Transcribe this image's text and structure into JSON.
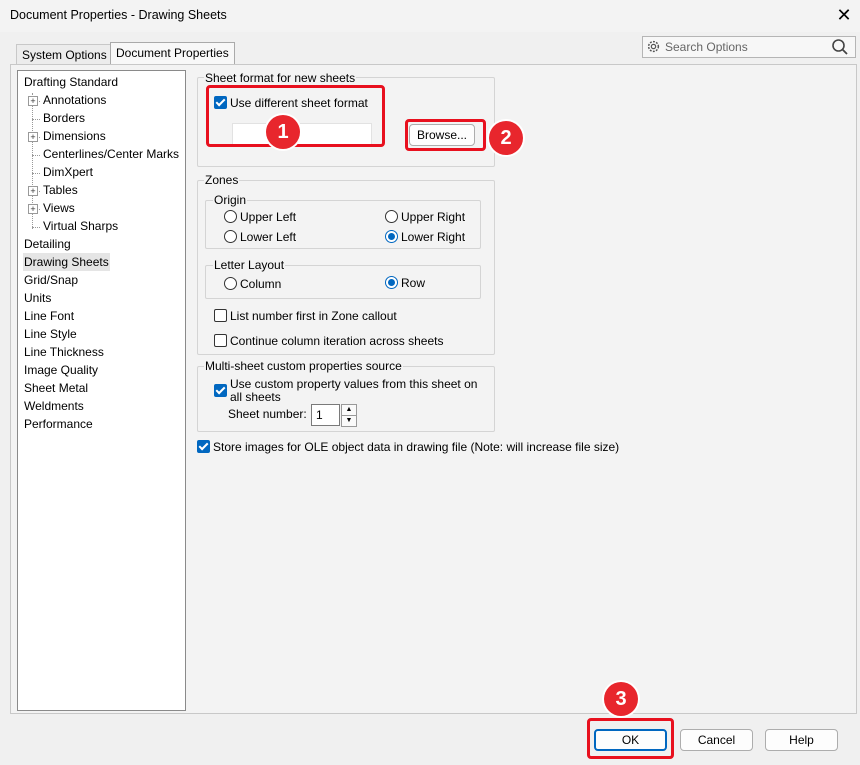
{
  "window": {
    "title": "Document Properties - Drawing Sheets",
    "close_label": "✕"
  },
  "tabs": [
    {
      "label": "System Options"
    },
    {
      "label": "Document Properties"
    }
  ],
  "search": {
    "placeholder": "Search Options"
  },
  "tree": {
    "items": [
      {
        "label": "Drafting Standard"
      },
      {
        "label": "Annotations"
      },
      {
        "label": "Borders"
      },
      {
        "label": "Dimensions"
      },
      {
        "label": "Centerlines/Center Marks"
      },
      {
        "label": "DimXpert"
      },
      {
        "label": "Tables"
      },
      {
        "label": "Views"
      },
      {
        "label": "Virtual Sharps"
      },
      {
        "label": "Detailing"
      },
      {
        "label": "Drawing Sheets"
      },
      {
        "label": "Grid/Snap"
      },
      {
        "label": "Units"
      },
      {
        "label": "Line Font"
      },
      {
        "label": "Line Style"
      },
      {
        "label": "Line Thickness"
      },
      {
        "label": "Image Quality"
      },
      {
        "label": "Sheet Metal"
      },
      {
        "label": "Weldments"
      },
      {
        "label": "Performance"
      }
    ],
    "selected": "Drawing Sheets"
  },
  "sheet_format": {
    "title": "Sheet format for new sheets",
    "use_different": {
      "label": "Use different sheet format",
      "checked": true
    },
    "path_value": "",
    "browse_label": "Browse..."
  },
  "zones": {
    "title": "Zones",
    "origin": {
      "title": "Origin",
      "options": [
        {
          "label": "Upper Left",
          "selected": false
        },
        {
          "label": "Upper Right",
          "selected": false
        },
        {
          "label": "Lower Left",
          "selected": false
        },
        {
          "label": "Lower Right",
          "selected": true
        }
      ]
    },
    "letter_layout": {
      "title": "Letter Layout",
      "options": [
        {
          "label": "Column",
          "selected": false
        },
        {
          "label": "Row",
          "selected": true
        }
      ]
    },
    "list_number_first": {
      "label": "List number first in Zone callout",
      "checked": false
    },
    "continue_iteration": {
      "label": "Continue column iteration across sheets",
      "checked": false
    }
  },
  "multi_sheet": {
    "title": "Multi-sheet custom properties source",
    "use_custom": {
      "label": "Use custom property values from this sheet on",
      "label2": "all sheets",
      "checked": true
    },
    "sheet_number_label": "Sheet number:",
    "sheet_number_value": "1"
  },
  "store_images": {
    "label": "Store images for OLE object data in drawing file (Note: will increase file size)",
    "checked": true
  },
  "buttons": {
    "ok": "OK",
    "cancel": "Cancel",
    "help": "Help"
  },
  "annotations": [
    {
      "number": "1"
    },
    {
      "number": "2"
    },
    {
      "number": "3"
    }
  ],
  "colors": {
    "accent": "#0067c0",
    "highlight": "#e8101e"
  }
}
